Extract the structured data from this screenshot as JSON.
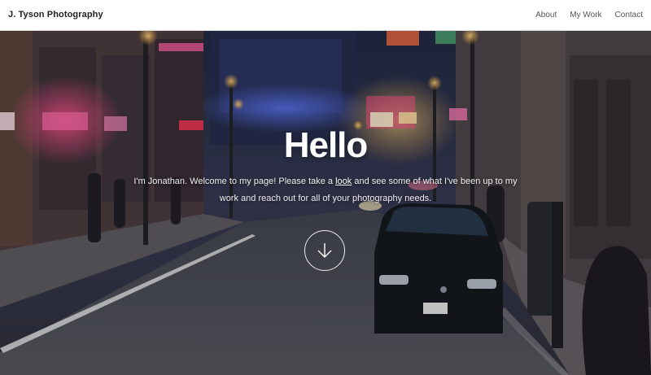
{
  "navbar": {
    "brand": "J. Tyson Photography",
    "links": [
      {
        "label": "About"
      },
      {
        "label": "My Work"
      },
      {
        "label": "Contact"
      }
    ]
  },
  "hero": {
    "title": "Hello",
    "intro_before_link": "I'm Jonathan. Welcome to my page! Please take a ",
    "link_text": "look",
    "intro_after_link": " and see some of what I've been up to my work and reach out for all of your photography needs.",
    "scroll_icon": "arrow-down-circle-icon"
  },
  "colors": {
    "navbar_bg": "#ffffff",
    "brand_text": "#222222",
    "nav_link_text": "#555555",
    "hero_text": "#ffffff"
  }
}
